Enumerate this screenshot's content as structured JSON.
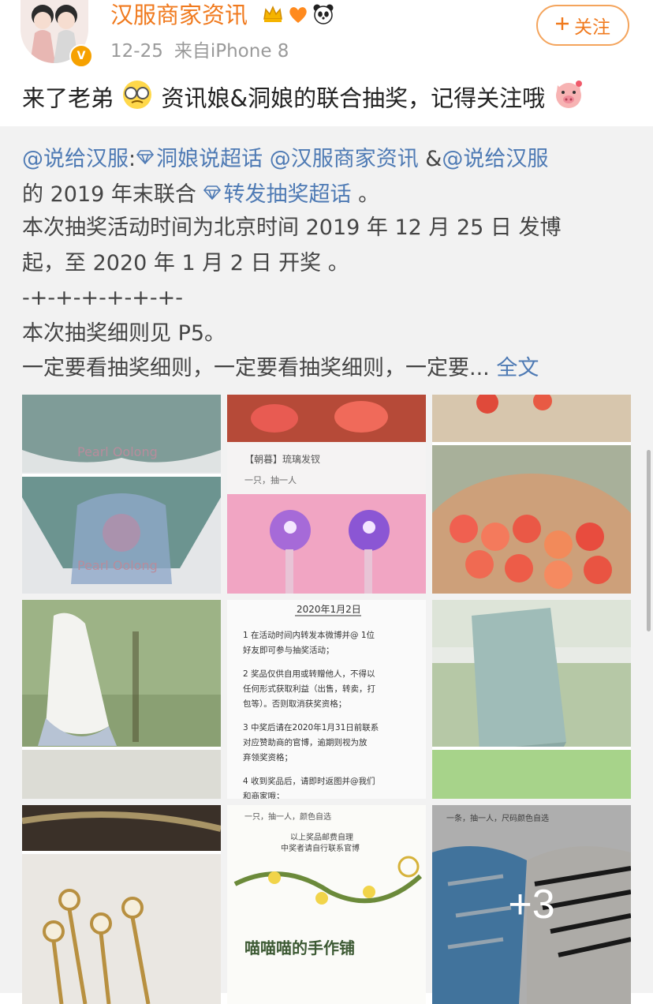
{
  "post": {
    "author": "汉服商家资讯",
    "date": "12-25",
    "source_prefix": "来自",
    "source": "iPhone 8",
    "follow_label": "关注",
    "title_part1": "来了老弟",
    "title_part2": "资讯娘&洞娘的联合抽奖，记得关注哦"
  },
  "repost": {
    "mention1": "@说给汉服",
    "colon": ":",
    "topic1": "洞娘说超话",
    "mention2": "@汉服商家资讯",
    "amp": " &",
    "mention3": "@说给汉服",
    "line2_pre": "的 2019 年末联合",
    "topic2": "转发抽奖超话",
    "line2_post": " 。",
    "line3": "本次抽奖活动时间为北京时间 2019 年 12 月 25 日 发博",
    "line4": "起，至 2020 年 1 月 2 日 开奖 。",
    "line5": "-+-+-+-+-+-+-",
    "line6": "本次抽奖细则见 P5。",
    "line7": "一定要看抽奖细则，一定要看抽奖细则，一定要... ",
    "full_text": "全文"
  },
  "images": {
    "img1_watermark": "Pearl Oolong",
    "img2_label": "【朝暮】琉璃发钗",
    "img2_sub": "一只，抽一人",
    "img5_title": "2020年1月2日",
    "img5_rules": [
      "1 在活动时间内转发本微博并@ 1位",
      "好友即可参与抽奖活动；",
      "2 奖品仅供自用或转赠他人，不得以",
      "任何形式获取利益（出售，转卖，打",
      "包等）。否则取消获奖资格；",
      "3 中奖后请在2020年1月31日前联系",
      "对应赞助商的官博，逾期则视为放",
      "弃领奖资格；",
      "4 收到奖品后，请即时返图并@我们",
      "和商家哦；"
    ],
    "img8_top": "一只，抽一人，颜色自选",
    "img8_note1": "以上奖品邮费自理",
    "img8_note2": "中奖者请自行联系官博",
    "img8_brand": "喵喵喵的手作铺",
    "img9_top": "一条，抽一人，尺码颜色自选",
    "more_count": "+3"
  },
  "colors": {
    "username": "#f07a1e",
    "link": "#4e7ab4",
    "repost_bg": "#f2f2f2",
    "verified_badge": "#f6a100"
  },
  "icons": [
    "crown-icon",
    "heart-icon",
    "panda-icon",
    "verified-icon",
    "plus-icon",
    "glasses-emoji-icon",
    "pig-emoji-icon",
    "diamond-icon"
  ]
}
